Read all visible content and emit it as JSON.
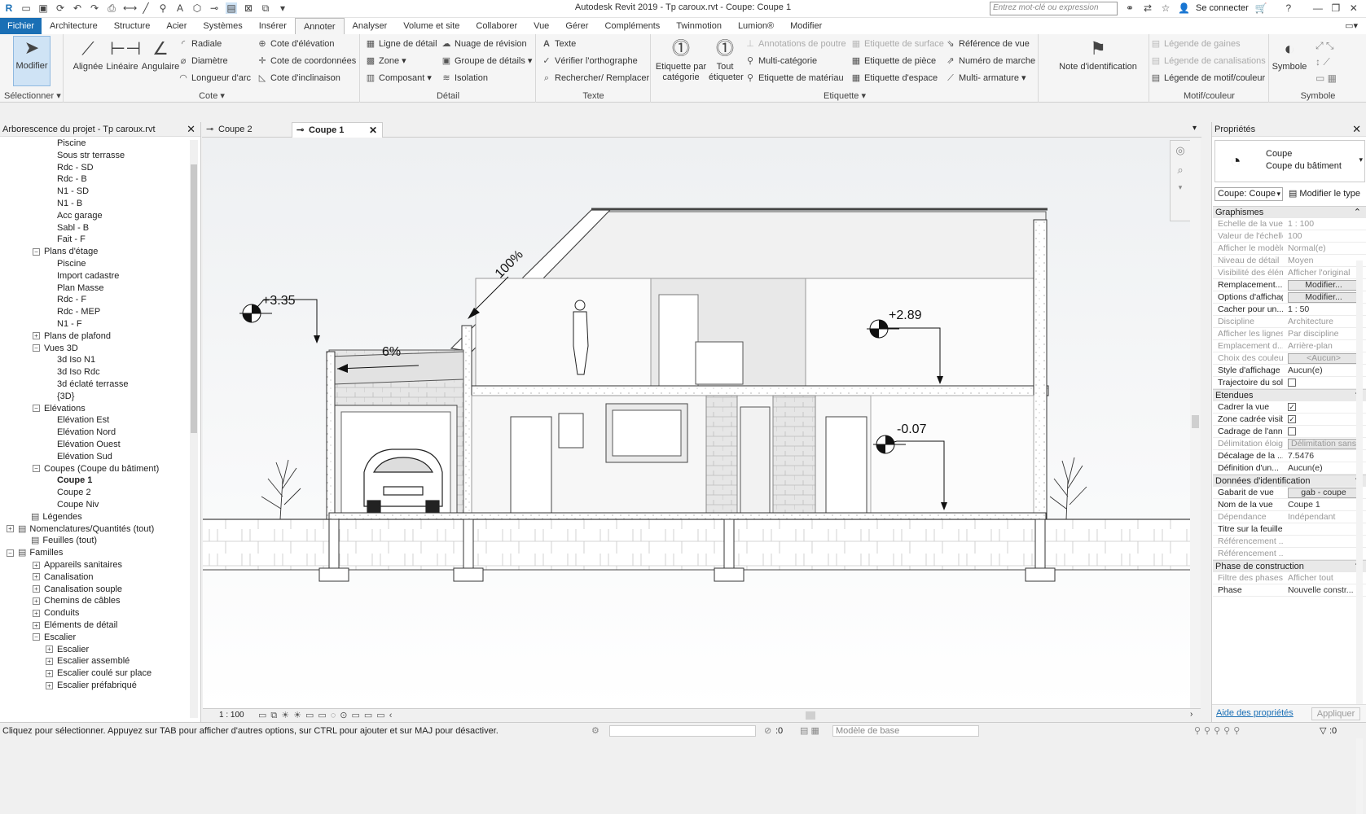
{
  "app_title": "Autodesk Revit 2019 - Tp caroux.rvt - Coupe: Coupe 1",
  "search_placeholder": "Entrez mot-clé ou expression",
  "sign_in": "Se connecter",
  "menu": [
    "Fichier",
    "Architecture",
    "Structure",
    "Acier",
    "Systèmes",
    "Insérer",
    "Annoter",
    "Analyser",
    "Volume et site",
    "Collaborer",
    "Vue",
    "Gérer",
    "Compléments",
    "Twinmotion",
    "Lumion®",
    "Modifier"
  ],
  "ribbon": {
    "select": {
      "modify": "Modifier",
      "panel": "Sélectionner"
    },
    "cote": {
      "aligned": "Alignée",
      "linear": "Linéaire",
      "angular": "Angulaire",
      "radial": "Radiale",
      "diameter": "Diamètre",
      "arc_length": "Longueur d'arc",
      "panel": "Cote"
    },
    "spot": {
      "elevation": "Cote d'élévation",
      "coordinate": "Cote de coordonnées",
      "slope": "Cote d'inclinaison"
    },
    "detail": {
      "detail_line": "Ligne de détail",
      "region": "Zone",
      "component": "Composant",
      "revision_cloud": "Nuage de révision",
      "detail_group": "Groupe de détails",
      "insulation": "Isolation",
      "panel": "Détail"
    },
    "text": {
      "text": "Texte",
      "spelling": "Vérifier l'orthographe",
      "find_replace": "Rechercher/ Remplacer",
      "panel": "Texte"
    },
    "tag": {
      "by_category": "Etiquette par catégorie",
      "tag_all": "Tout étiqueter",
      "beam_annot": "Annotations de poutre",
      "multi_category": "Multi-catégorie",
      "material": "Etiquette de matériau",
      "surface": "Etiquette de surface",
      "room": "Etiquette de pièce",
      "space": "Etiquette d'espace",
      "view_ref": "Référence de vue",
      "tread_number": "Numéro de marche",
      "multi_rebar": "Multi- armature",
      "keynote": "Note d'identification",
      "panel": "Etiquette"
    },
    "color_fill": {
      "duct_legend": "Légende de gaines",
      "pipe_legend": "Légende de canalisations",
      "pattern_legend": "Légende de motif/couleur",
      "panel": "Motif/couleur"
    },
    "symbol": {
      "symbol": "Symbole",
      "panel": "Symbole"
    }
  },
  "browser": {
    "title": "Arborescence du projet - Tp caroux.rvt",
    "rows": [
      {
        "label": "Piscine",
        "indent": 3,
        "toggle": ""
      },
      {
        "label": "Sous str terrasse",
        "indent": 3,
        "toggle": ""
      },
      {
        "label": "Rdc - SD",
        "indent": 3,
        "toggle": ""
      },
      {
        "label": "Rdc - B",
        "indent": 3,
        "toggle": ""
      },
      {
        "label": "N1 - SD",
        "indent": 3,
        "toggle": ""
      },
      {
        "label": "N1 - B",
        "indent": 3,
        "toggle": ""
      },
      {
        "label": "Acc garage",
        "indent": 3,
        "toggle": ""
      },
      {
        "label": "Sabl - B",
        "indent": 3,
        "toggle": ""
      },
      {
        "label": "Fait - F",
        "indent": 3,
        "toggle": ""
      },
      {
        "label": "Plans d'étage",
        "indent": 2,
        "toggle": "−"
      },
      {
        "label": "Piscine",
        "indent": 3,
        "toggle": ""
      },
      {
        "label": "Import cadastre",
        "indent": 3,
        "toggle": ""
      },
      {
        "label": "Plan Masse",
        "indent": 3,
        "toggle": ""
      },
      {
        "label": "Rdc - F",
        "indent": 3,
        "toggle": ""
      },
      {
        "label": "Rdc - MEP",
        "indent": 3,
        "toggle": ""
      },
      {
        "label": "N1 - F",
        "indent": 3,
        "toggle": ""
      },
      {
        "label": "Plans de plafond",
        "indent": 2,
        "toggle": "+"
      },
      {
        "label": "Vues 3D",
        "indent": 2,
        "toggle": "−"
      },
      {
        "label": "3d Iso N1",
        "indent": 3,
        "toggle": ""
      },
      {
        "label": "3d Iso Rdc",
        "indent": 3,
        "toggle": ""
      },
      {
        "label": "3d éclaté terrasse",
        "indent": 3,
        "toggle": ""
      },
      {
        "label": "{3D}",
        "indent": 3,
        "toggle": ""
      },
      {
        "label": "Elévations",
        "indent": 2,
        "toggle": "−"
      },
      {
        "label": "Elévation Est",
        "indent": 3,
        "toggle": ""
      },
      {
        "label": "Elévation Nord",
        "indent": 3,
        "toggle": ""
      },
      {
        "label": "Elévation Ouest",
        "indent": 3,
        "toggle": ""
      },
      {
        "label": "Elévation Sud",
        "indent": 3,
        "toggle": ""
      },
      {
        "label": "Coupes (Coupe du bâtiment)",
        "indent": 2,
        "toggle": "−"
      },
      {
        "label": "Coupe 1",
        "indent": 3,
        "toggle": "",
        "bold": true
      },
      {
        "label": "Coupe 2",
        "indent": 3,
        "toggle": ""
      },
      {
        "label": "Coupe Niv",
        "indent": 3,
        "toggle": ""
      },
      {
        "label": "Légendes",
        "indent": 1,
        "toggle": "",
        "icon": true
      },
      {
        "label": "Nomenclatures/Quantités (tout)",
        "indent": 0,
        "toggle": "+",
        "icon": true
      },
      {
        "label": "Feuilles (tout)",
        "indent": 1,
        "toggle": "",
        "icon": true
      },
      {
        "label": "Familles",
        "indent": 0,
        "toggle": "−",
        "icon": true
      },
      {
        "label": "Appareils sanitaires",
        "indent": 2,
        "toggle": "+"
      },
      {
        "label": "Canalisation",
        "indent": 2,
        "toggle": "+"
      },
      {
        "label": "Canalisation souple",
        "indent": 2,
        "toggle": "+"
      },
      {
        "label": "Chemins de câbles",
        "indent": 2,
        "toggle": "+"
      },
      {
        "label": "Conduits",
        "indent": 2,
        "toggle": "+"
      },
      {
        "label": "Eléments de détail",
        "indent": 2,
        "toggle": "+"
      },
      {
        "label": "Escalier",
        "indent": 2,
        "toggle": "−"
      },
      {
        "label": "Escalier",
        "indent": 3,
        "toggle": "+"
      },
      {
        "label": "Escalier assemblé",
        "indent": 3,
        "toggle": "+"
      },
      {
        "label": "Escalier coulé sur place",
        "indent": 3,
        "toggle": "+"
      },
      {
        "label": "Escalier préfabriqué",
        "indent": 3,
        "toggle": "+"
      }
    ]
  },
  "tabs": [
    {
      "label": "Coupe 2",
      "active": false
    },
    {
      "label": "Coupe 1",
      "active": true
    }
  ],
  "drawing": {
    "slope_roof": "100%",
    "slope_garage": "6%",
    "lvl_garage": "+3.35",
    "lvl_floor1": "+2.89",
    "lvl_ground": "-0.07"
  },
  "view_scale": "1 : 100",
  "properties": {
    "title": "Propriétés",
    "family": "Coupe",
    "type": "Coupe du bâtiment",
    "type_select": "Coupe: Coupe",
    "edit_type": "Modifier le type",
    "sections": [
      {
        "name": "Graphismes",
        "rows": [
          {
            "k": "Echelle de la vue",
            "v": "1 : 100",
            "dis": true
          },
          {
            "k": "Valeur de l'échelle",
            "v": "100",
            "dis": true
          },
          {
            "k": "Afficher le modèle",
            "v": "Normal(e)",
            "dis": true
          },
          {
            "k": "Niveau de détail",
            "v": "Moyen",
            "dis": true
          },
          {
            "k": "Visibilité des éléments",
            "v": "Afficher l'original",
            "dis": true
          },
          {
            "k": "Remplacement...",
            "v": "Modifier...",
            "btn": true
          },
          {
            "k": "Options d'affichage",
            "v": "Modifier...",
            "btn": true
          },
          {
            "k": "Cacher pour un...",
            "v": "1 : 50"
          },
          {
            "k": "Discipline",
            "v": "Architecture",
            "dis": true
          },
          {
            "k": "Afficher les lignes",
            "v": "Par discipline",
            "dis": true
          },
          {
            "k": "Emplacement d...",
            "v": "Arrière-plan",
            "dis": true
          },
          {
            "k": "Choix des couleurs",
            "v": "<Aucun>",
            "dis": true,
            "btn": true
          },
          {
            "k": "Style d'affichage",
            "v": "Aucun(e)"
          },
          {
            "k": "Trajectoire du soleil",
            "v": "",
            "chk": false
          }
        ]
      },
      {
        "name": "Etendues",
        "rows": [
          {
            "k": "Cadrer la vue",
            "v": "",
            "chk": true
          },
          {
            "k": "Zone cadrée visible",
            "v": "",
            "chk": true
          },
          {
            "k": "Cadrage de l'annotation",
            "v": "",
            "chk": false
          },
          {
            "k": "Délimitation éloignée",
            "v": "Délimitation sans",
            "dis": true,
            "btn": true
          },
          {
            "k": "Décalage de la ...",
            "v": "7.5476"
          },
          {
            "k": "Définition d'un...",
            "v": "Aucun(e)"
          }
        ]
      },
      {
        "name": "Données d'identification",
        "rows": [
          {
            "k": "Gabarit de vue",
            "v": "gab - coupe",
            "btn": true
          },
          {
            "k": "Nom de la vue",
            "v": "Coupe 1"
          },
          {
            "k": "Dépendance",
            "v": "Indépendant",
            "dis": true
          },
          {
            "k": "Titre sur la feuille",
            "v": ""
          },
          {
            "k": "Référencement ...",
            "v": "",
            "dis": true
          },
          {
            "k": "Référencement ...",
            "v": "",
            "dis": true
          }
        ]
      },
      {
        "name": "Phase de construction",
        "rows": [
          {
            "k": "Filtre des phases",
            "v": "Afficher tout",
            "dis": true
          },
          {
            "k": "Phase",
            "v": "Nouvelle constr..."
          }
        ]
      }
    ],
    "help_link": "Aide des propriétés",
    "apply": "Appliquer"
  },
  "status": {
    "hint": "Cliquez pour sélectionner. Appuyez sur TAB pour afficher d'autres options, sur CTRL pour ajouter et sur MAJ pour désactiver.",
    "workset": ":0",
    "model": "Modèle de base",
    "sel_count": ":0"
  }
}
